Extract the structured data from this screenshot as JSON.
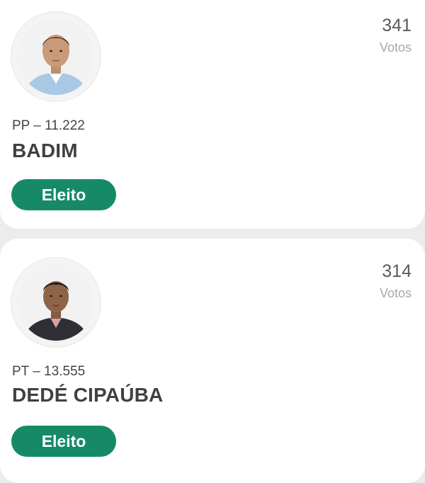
{
  "candidates": [
    {
      "votes": "341",
      "votes_label": "Votos",
      "party": "PP – 11.222",
      "name": "BADIM",
      "status": "Eleito",
      "colors": {
        "shirt": "#a9c8e6",
        "skin": "#c99a78",
        "hair": "#2a2420"
      }
    },
    {
      "votes": "314",
      "votes_label": "Votos",
      "party": "PT – 13.555",
      "name": "DEDÉ CIPAÚBA",
      "status": "Eleito",
      "colors": {
        "shirt": "#2f2f35",
        "skin": "#8e6448",
        "hair": "#1d1a18"
      }
    }
  ],
  "accent_color": "#168a66"
}
